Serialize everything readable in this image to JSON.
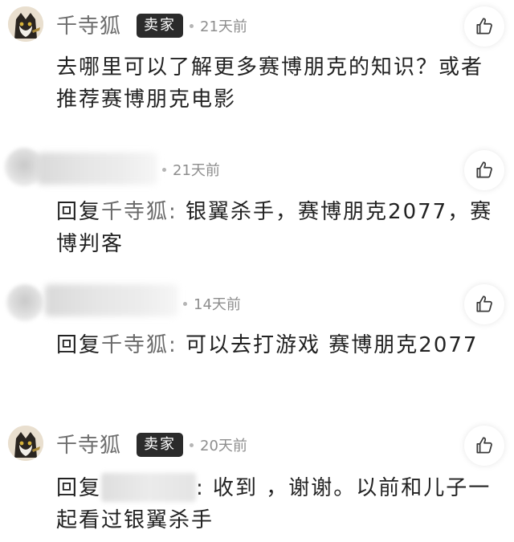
{
  "comments": [
    {
      "author": "千寺狐",
      "badge": "卖家",
      "time": "21天前",
      "text": "去哪里可以了解更多赛博朋克的知识？或者推荐赛博朋克电影"
    },
    {
      "author": "",
      "time": "21天前",
      "reply_label": "回复",
      "mention": "千寺狐:",
      "text": "  银翼杀手，赛博朋克2077，赛博判客"
    },
    {
      "author": "",
      "time": "14天前",
      "reply_label": "回复",
      "mention": "千寺狐:",
      "text": " 可以去打游戏  赛博朋克2077"
    },
    {
      "author": "千寺狐",
      "badge": "卖家",
      "time": "20天前",
      "reply_label": "回复",
      "text": ": 收到  ，谢谢。以前和儿子一起看过银翼杀手"
    }
  ]
}
